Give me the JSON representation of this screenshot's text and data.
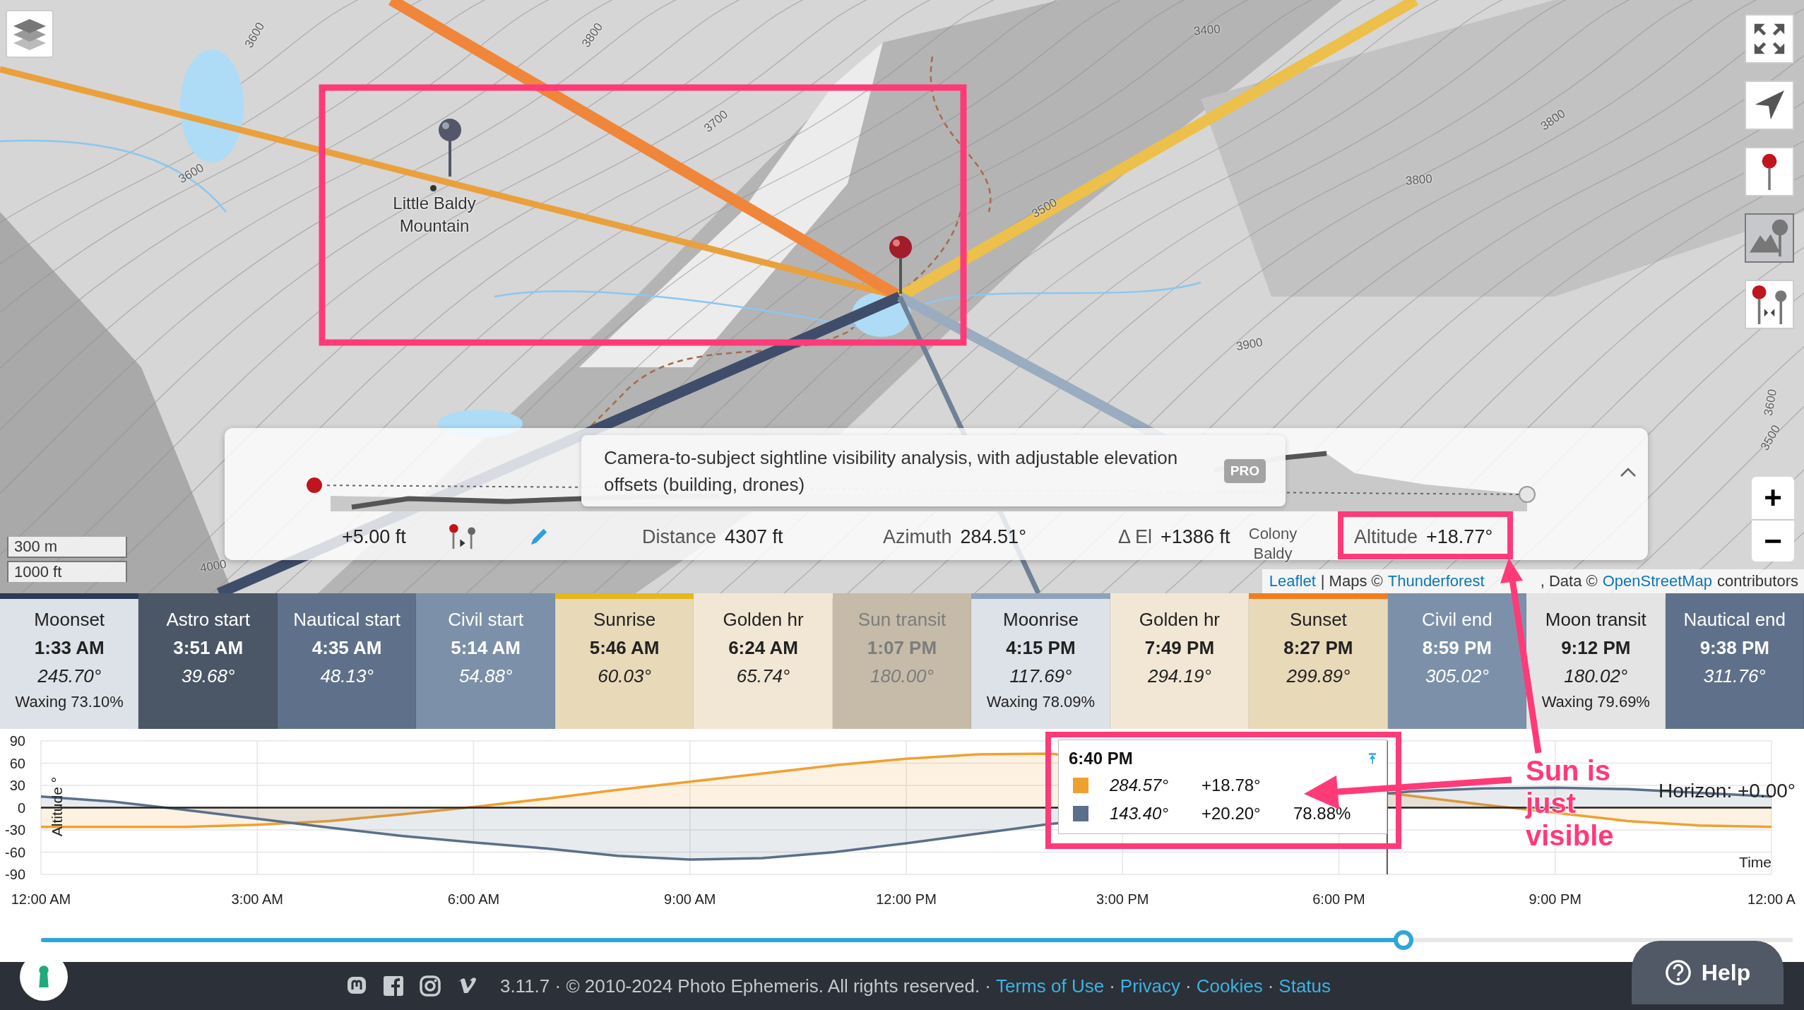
{
  "map": {
    "contour_labels": [
      "3600",
      "3600",
      "3800",
      "3700",
      "3400",
      "3800",
      "3800",
      "3500",
      "3900",
      "3600",
      "3500",
      "4000"
    ],
    "place_labels": [
      {
        "text": "Little Baldy Mountain"
      },
      {
        "text": "Colony Baldy"
      }
    ],
    "toolbar": [
      {
        "kind": "fullscreen",
        "selected": false
      },
      {
        "kind": "locate",
        "selected": false
      },
      {
        "kind": "pin",
        "selected": false
      },
      {
        "kind": "scene",
        "selected": true
      },
      {
        "kind": "pins",
        "selected": false
      }
    ],
    "zoom": [
      "+",
      "−"
    ],
    "scale": [
      "300 m",
      "1000 ft"
    ],
    "attribution": [
      {
        "kind": "link",
        "text": "Leaflet"
      },
      {
        "kind": "text",
        "text": "| Maps ©"
      },
      {
        "kind": "link",
        "text": "Thunderforest"
      },
      {
        "kind": "text",
        "text": ", Data ©"
      },
      {
        "kind": "link",
        "text": "OpenStreetMap"
      },
      {
        "kind": "text",
        "text": "contributors"
      }
    ]
  },
  "profile": {
    "message": "Camera-to-subject sightline visibility analysis, with adjustable elevation offsets (building, drones)",
    "badge": "PRO",
    "offset": "+5.00 ft",
    "stats": [
      {
        "label": "Distance",
        "value": "4307 ft"
      },
      {
        "label": "Azimuth",
        "value": "284.51°"
      },
      {
        "label": "Δ El",
        "value": "+1386 ft"
      },
      {
        "label": "Altitude",
        "value": "+18.77°"
      }
    ]
  },
  "events": [
    {
      "name": "Moonset",
      "time": "1:33 AM",
      "azimuth": "245.70°",
      "phase": "Waxing 73.10%",
      "color": "#dde2e8",
      "marker": {
        "color": "#2b3a56"
      },
      "kind": "light"
    },
    {
      "name": "Astro start",
      "time": "3:51 AM",
      "azimuth": "39.68°",
      "color": "#4b5667",
      "kind": "dark"
    },
    {
      "name": "Nautical start",
      "time": "4:35 AM",
      "azimuth": "48.13°",
      "color": "#5f718a",
      "kind": "dark"
    },
    {
      "name": "Civil start",
      "time": "5:14 AM",
      "azimuth": "54.88°",
      "color": "#7c91a9",
      "kind": "dark"
    },
    {
      "name": "Sunrise",
      "time": "5:46 AM",
      "azimuth": "60.03°",
      "color": "#e8d9b9",
      "marker": {
        "color": "#e6b61e"
      },
      "kind": "light"
    },
    {
      "name": "Golden hr",
      "time": "6:24 AM",
      "azimuth": "65.74°",
      "color": "#f1e7d4",
      "kind": "light"
    },
    {
      "name": "Sun transit",
      "time": "1:07 PM",
      "azimuth": "180.00°",
      "color": "#c5bba8",
      "kind": "muted"
    },
    {
      "name": "Moonrise",
      "time": "4:15 PM",
      "azimuth": "117.69°",
      "phase": "Waxing 78.09%",
      "color": "#dde2e8",
      "marker": {
        "color": "#8ea3ba"
      },
      "kind": "light"
    },
    {
      "name": "Golden hr",
      "time": "7:49 PM",
      "azimuth": "294.19°",
      "color": "#f1e7d4",
      "kind": "light"
    },
    {
      "name": "Sunset",
      "time": "8:27 PM",
      "azimuth": "299.89°",
      "color": "#e8d9b9",
      "marker": {
        "color": "#f07d1e"
      },
      "kind": "light"
    },
    {
      "name": "Civil end",
      "time": "8:59 PM",
      "azimuth": "305.02°",
      "color": "#7c91a9",
      "kind": "dark"
    },
    {
      "name": "Moon transit",
      "time": "9:12 PM",
      "azimuth": "180.02°",
      "phase": "Waxing 79.69%",
      "color": "#e4e4e4",
      "kind": "light"
    },
    {
      "name": "Nautical end",
      "time": "9:38 PM",
      "azimuth": "311.76°",
      "color": "#5f718a",
      "kind": "dark"
    }
  ],
  "chart": {
    "chart_data": {
      "type": "area",
      "xlabel": "Time",
      "ylabel": "Altitude °",
      "x": [
        0,
        1,
        2,
        3,
        4,
        5,
        6,
        7,
        8,
        9,
        10,
        11,
        12,
        13,
        14,
        19,
        20,
        21,
        22,
        23,
        24
      ],
      "series": [
        {
          "color": "#f0a030",
          "values": [
            -26,
            -26,
            -26,
            -23,
            -18,
            -9,
            1,
            12,
            24,
            35,
            46,
            57,
            66,
            72,
            73,
            16,
            4,
            -7,
            -18,
            -24,
            -26
          ]
        },
        {
          "color": "#5b6f8a",
          "values": [
            15,
            8,
            -3,
            -15,
            -27,
            -38,
            -47,
            -55,
            -65,
            -70,
            -68,
            -60,
            -48,
            -35,
            -22,
            22,
            26,
            27,
            25,
            20,
            15
          ]
        }
      ],
      "grid": true,
      "ref_lines": [
        {
          "axis": "y",
          "value": 0
        },
        {
          "axis": "x",
          "value": 18.67
        }
      ],
      "xlim": [
        0,
        24
      ],
      "ylim": [
        -90,
        90
      ],
      "xticks": [
        {
          "value": 0,
          "label": "12:00 AM"
        },
        {
          "value": 3,
          "label": "3:00 AM"
        },
        {
          "value": 6,
          "label": "6:00 AM"
        },
        {
          "value": 9,
          "label": "9:00 AM"
        },
        {
          "value": 12,
          "label": "12:00 PM"
        },
        {
          "value": 15,
          "label": "3:00 PM"
        },
        {
          "value": 18,
          "label": "6:00 PM"
        },
        {
          "value": 21,
          "label": "9:00 PM"
        },
        {
          "value": 24,
          "label": "12:00 A"
        }
      ],
      "yticks": [
        90,
        60,
        30,
        0,
        -30,
        -60,
        -90
      ],
      "annotations": [
        {
          "text": "Horizon: +0.00°"
        }
      ]
    },
    "tooltip": {
      "time": "6:40 PM",
      "rows": [
        {
          "color": "#f0a030",
          "azimuth": "284.57°",
          "altitude": "+18.78°"
        },
        {
          "color": "#5b6f8a",
          "azimuth": "143.40°",
          "altitude": "+20.20°",
          "illumination": "78.88%"
        }
      ]
    }
  },
  "slider": {
    "level": 0.778
  },
  "footer": {
    "items": [
      {
        "kind": "text",
        "text": "3.11.7 · © 2010-2024 Photo Ephemeris. All rights reserved. ·"
      },
      {
        "kind": "link",
        "text": "Terms of Use"
      },
      {
        "kind": "text",
        "text": "·"
      },
      {
        "kind": "link",
        "text": "Privacy"
      },
      {
        "kind": "text",
        "text": "·"
      },
      {
        "kind": "link",
        "text": "Cookies"
      },
      {
        "kind": "text",
        "text": "·"
      },
      {
        "kind": "link",
        "text": "Status"
      }
    ],
    "help": "Help"
  },
  "annotation": {
    "callout": "Sun is just visible"
  }
}
